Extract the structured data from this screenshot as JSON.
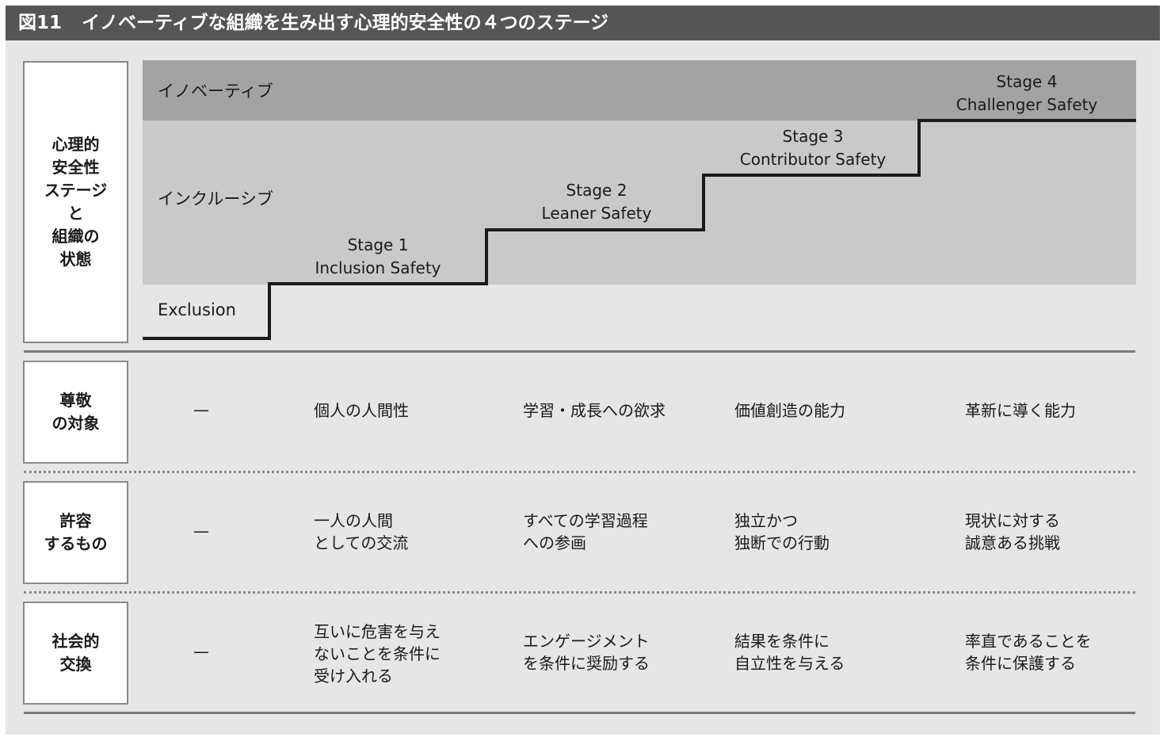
{
  "header": {
    "figure_number": "図11",
    "title": "イノベーティブな組織を生み出す心理的安全性の４つのステージ"
  },
  "diagram": {
    "side_label": "心理的\n安全性\nステージ\nと\n組織の\n状態",
    "bands": {
      "innovative": "イノベーティブ",
      "inclusive": "インクルーシブ",
      "exclusion": "Exclusion"
    },
    "stages": [
      {
        "stage": "Stage 1",
        "name": "Inclusion Safety"
      },
      {
        "stage": "Stage 2",
        "name": "Leaner Safety"
      },
      {
        "stage": "Stage 3",
        "name": "Contributor Safety"
      },
      {
        "stage": "Stage 4",
        "name": "Challenger Safety"
      }
    ],
    "colors": {
      "title_bg": "#555555",
      "innovative_band": "#a3a3a3",
      "inclusive_band": "#c9c9c9",
      "background": "#e6e6e6",
      "step_line": "#1a1a1a"
    }
  },
  "table": {
    "rows": [
      {
        "label": "尊敬\nの対象",
        "exclusion": "—",
        "cells": [
          "個人の人間性",
          "学習・成長への欲求",
          "価値創造の能力",
          "革新に導く能力"
        ]
      },
      {
        "label": "許容\nするもの",
        "exclusion": "—",
        "cells": [
          "一人の人間\nとしての交流",
          "すべての学習過程\nへの参画",
          "独立かつ\n独断での行動",
          "現状に対する\n誠意ある挑戦"
        ]
      },
      {
        "label": "社会的\n交換",
        "exclusion": "—",
        "cells": [
          "互いに危害を与え\nないことを条件に\n受け入れる",
          "エンゲージメント\nを条件に奨励する",
          "結果を条件に\n自立性を与える",
          "率直であることを\n条件に保護する"
        ]
      }
    ]
  }
}
